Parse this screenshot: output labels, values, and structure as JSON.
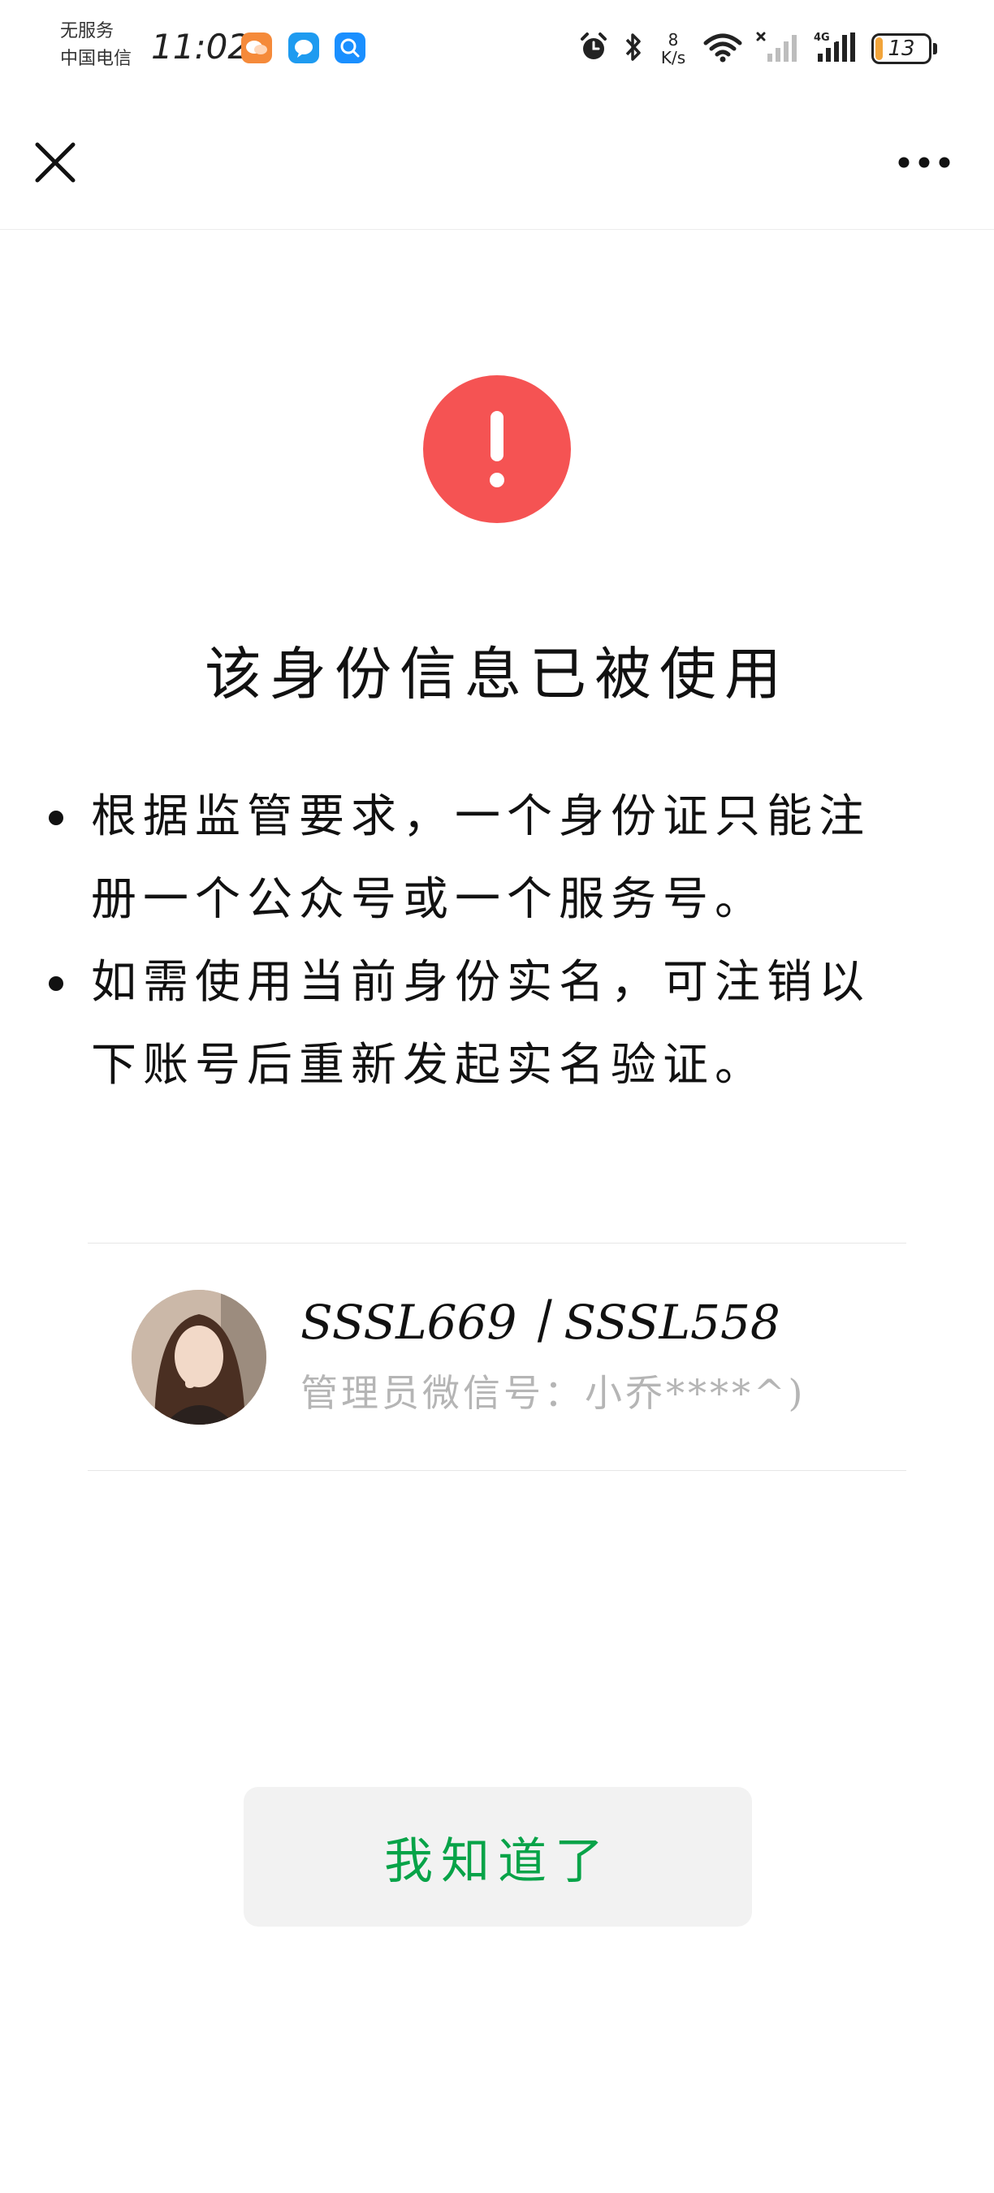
{
  "status_bar": {
    "carrier_line1": "无服务",
    "carrier_line2": "中国电信",
    "time": "11:02",
    "net_speed_value": "8",
    "net_speed_unit": "K/s",
    "battery_level": "13",
    "battery_fraction": 0.13,
    "app_icons": [
      "orange-chat-app-icon",
      "blue-message-app-icon",
      "blue-search-app-icon"
    ],
    "indicator_icons": [
      "alarm-icon",
      "bluetooth-icon",
      "wifi-icon",
      "signal-no-sim-icon",
      "signal-4g-icon"
    ]
  },
  "nav": {
    "close_icon": "close-icon",
    "more_icon": "more-icon"
  },
  "dialog": {
    "icon": "exclamation-icon",
    "icon_color": "#f55353",
    "title": "该身份信息已被使用",
    "bullets": [
      "根据监管要求，一个身份证只能注册一个公众号或一个服务号。",
      "如需使用当前身份实名，可注销以下账号后重新发起实名验证。"
    ]
  },
  "account": {
    "name": "SSSL669丨SSSL558",
    "admin_label": "管理员微信号：",
    "admin_value": "小乔****^)"
  },
  "confirm": {
    "label": "我知道了",
    "color": "#07a348"
  }
}
